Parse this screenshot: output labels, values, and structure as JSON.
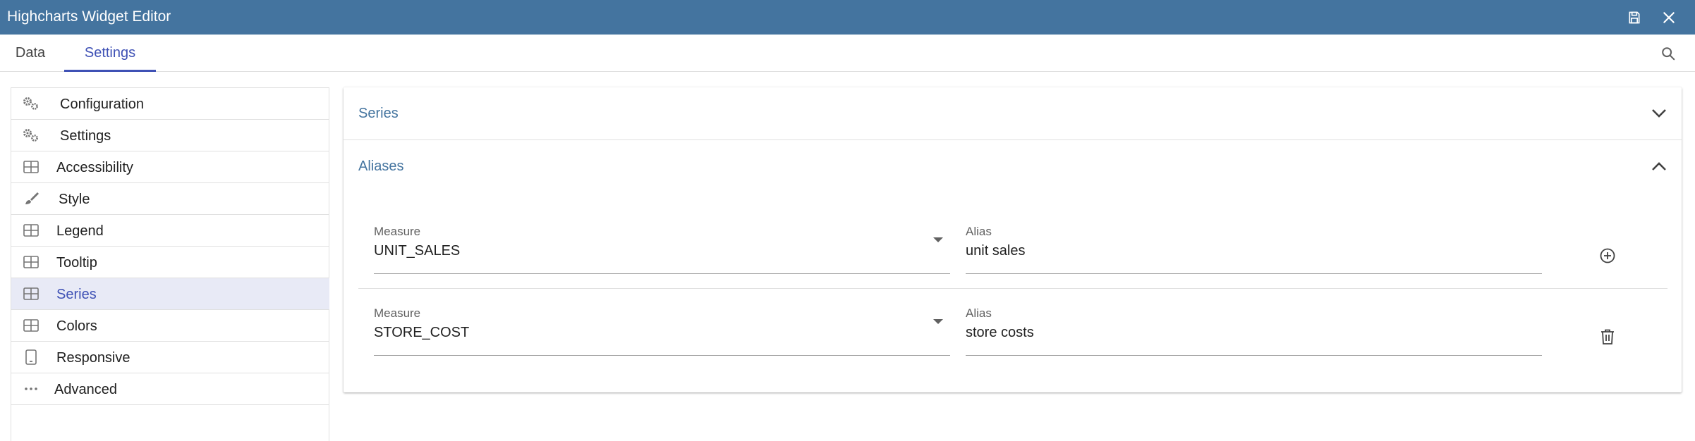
{
  "window": {
    "title": "Highcharts Widget Editor",
    "save_icon": "save-icon",
    "close_icon": "close-icon"
  },
  "tabs": [
    {
      "label": "Data",
      "active": false
    },
    {
      "label": "Settings",
      "active": true
    }
  ],
  "search_icon": "search-icon",
  "sidebar": {
    "items": [
      {
        "label": "Configuration",
        "icon": "gears-icon",
        "active": false
      },
      {
        "label": "Settings",
        "icon": "gears-icon",
        "active": false
      },
      {
        "label": "Accessibility",
        "icon": "table-icon",
        "active": false
      },
      {
        "label": "Style",
        "icon": "brush-icon",
        "active": false
      },
      {
        "label": "Legend",
        "icon": "table-icon",
        "active": false
      },
      {
        "label": "Tooltip",
        "icon": "table-icon",
        "active": false
      },
      {
        "label": "Series",
        "icon": "table-icon",
        "active": true
      },
      {
        "label": "Colors",
        "icon": "table-icon",
        "active": false
      },
      {
        "label": "Responsive",
        "icon": "tablet-icon",
        "active": false
      },
      {
        "label": "Advanced",
        "icon": "more-horiz-icon",
        "active": false
      }
    ]
  },
  "main": {
    "sections": [
      {
        "title": "Series",
        "expanded": false
      },
      {
        "title": "Aliases",
        "expanded": true
      }
    ],
    "aliases": {
      "rows": [
        {
          "measure_label": "Measure",
          "measure_value": "UNIT_SALES",
          "alias_label": "Alias",
          "alias_value": "unit sales",
          "action": "add-circle-icon"
        },
        {
          "measure_label": "Measure",
          "measure_value": "STORE_COST",
          "alias_label": "Alias",
          "alias_value": "store costs",
          "action": "delete-icon"
        }
      ]
    }
  },
  "colors": {
    "titlebar": "#44749f",
    "accent": "#3f51b5",
    "section_title": "#44749f",
    "active_item_bg": "#e8eaf6"
  }
}
